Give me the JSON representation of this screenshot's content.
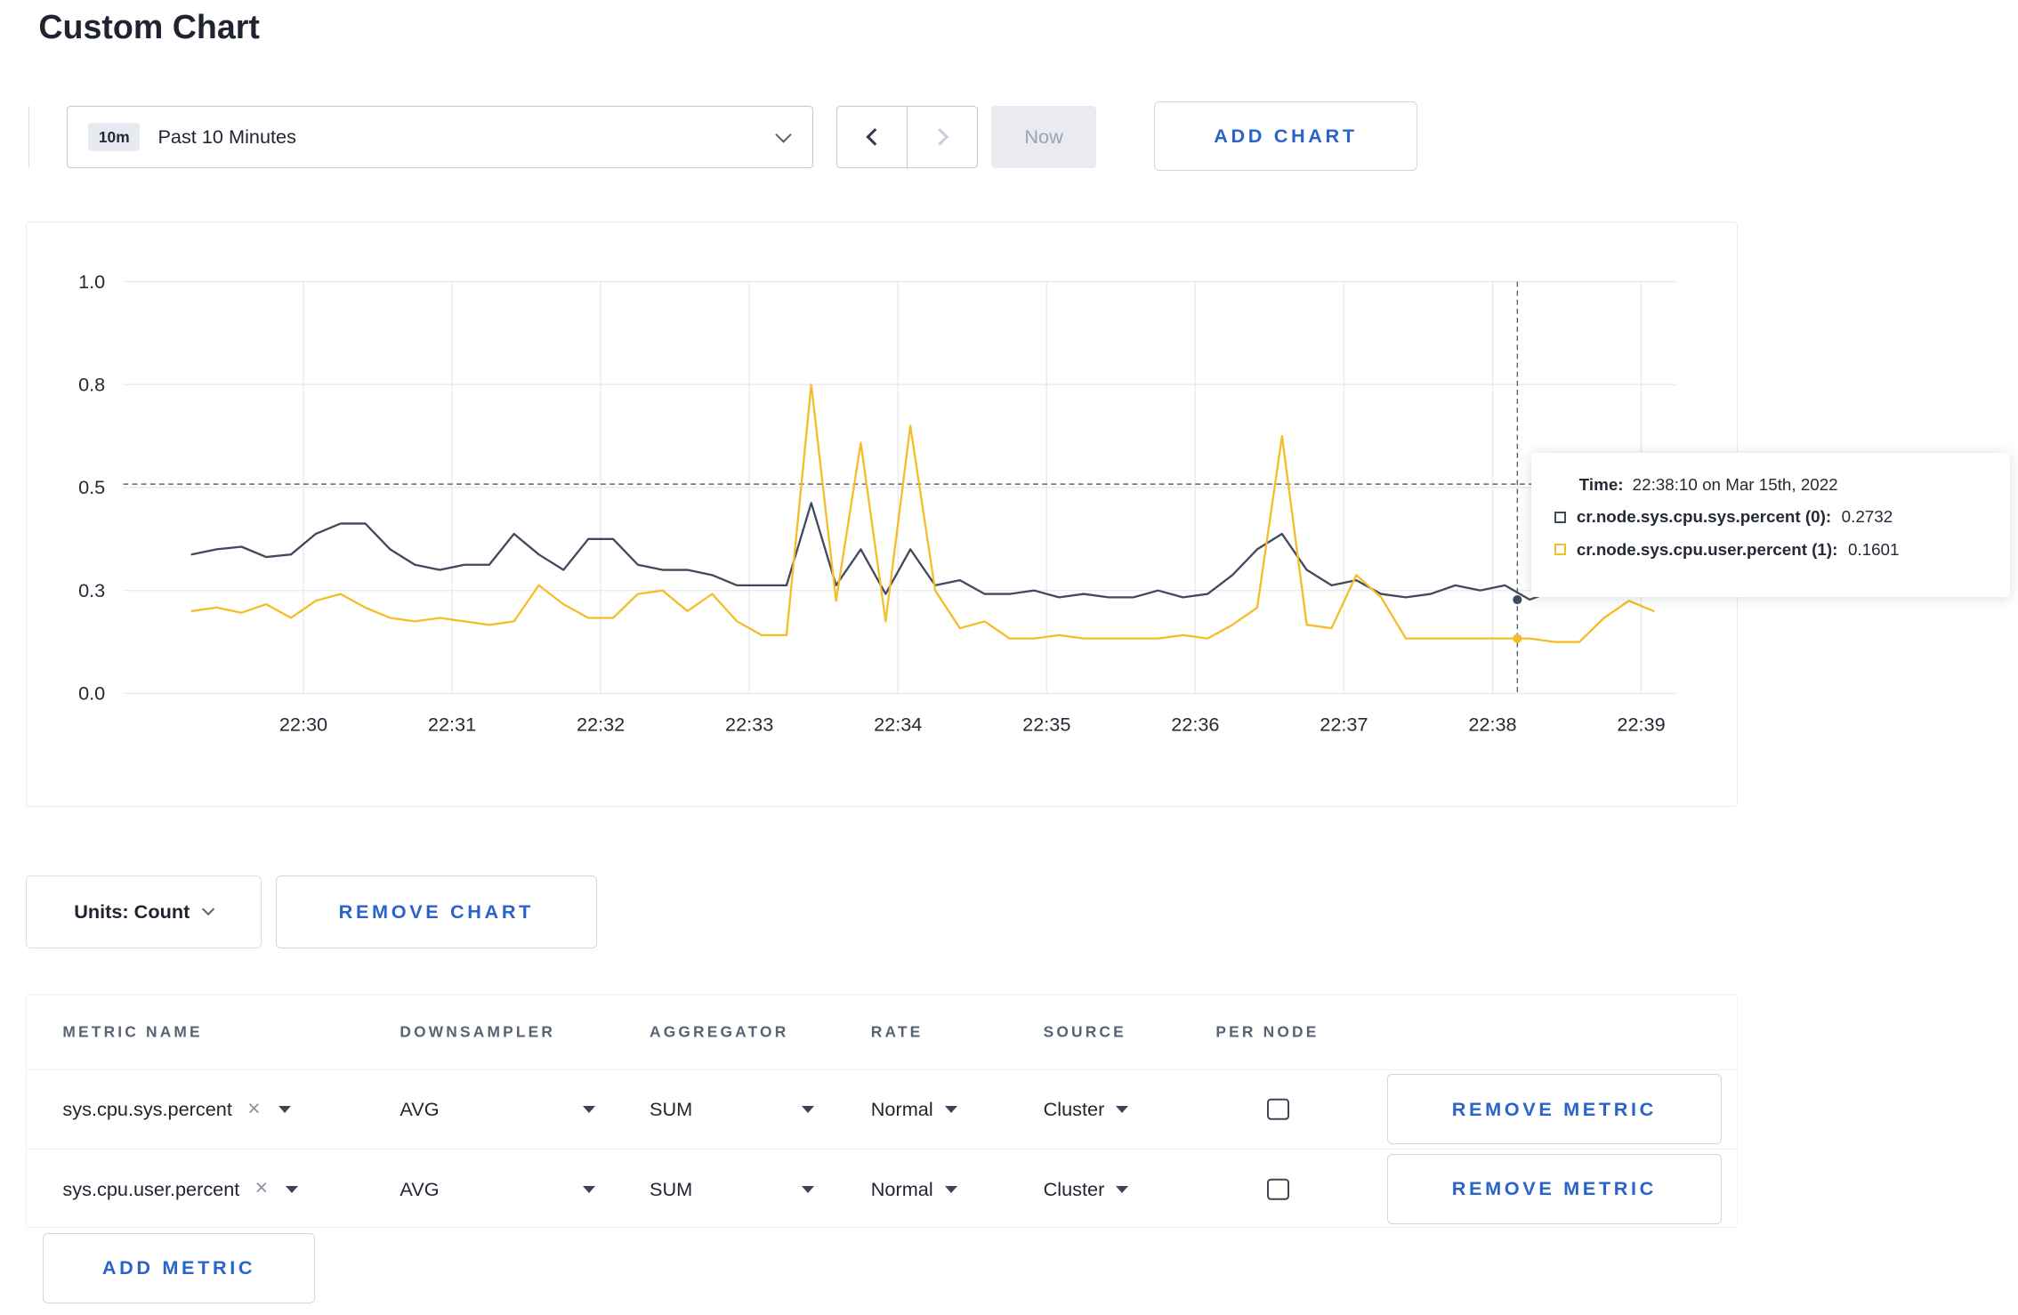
{
  "page": {
    "title": "Custom Chart"
  },
  "colors": {
    "accent_blue": "#2a63c9",
    "series_sys": "#3f4a5c",
    "series_user": "#f5bd27",
    "gridline": "#e9ebf0",
    "crosshair": "#5a6578"
  },
  "icons": {
    "remove_tag": "×"
  },
  "toolbar": {
    "range_badge": "10m",
    "range_label": "Past 10 Minutes",
    "now_label": "Now",
    "add_chart_label": "ADD CHART"
  },
  "tooltip": {
    "time_label": "Time:",
    "time_value": "22:38:10 on Mar 15th, 2022",
    "series": [
      {
        "label": "cr.node.sys.cpu.sys.percent (0):",
        "value": "0.2732",
        "color": "#3f4a5c"
      },
      {
        "label": "cr.node.sys.cpu.user.percent (1):",
        "value": "0.1601",
        "color": "#f5bd27"
      }
    ]
  },
  "units": {
    "label": "Units: Count",
    "remove_chart_label": "REMOVE CHART"
  },
  "metrics": {
    "headers": [
      "METRIC NAME",
      "DOWNSAMPLER",
      "AGGREGATOR",
      "RATE",
      "SOURCE",
      "PER NODE"
    ],
    "rows": [
      {
        "name": "sys.cpu.sys.percent",
        "downsampler": "AVG",
        "aggregator": "SUM",
        "rate": "Normal",
        "source": "Cluster",
        "per_node_checked": false,
        "remove_label": "REMOVE METRIC"
      },
      {
        "name": "sys.cpu.user.percent",
        "downsampler": "AVG",
        "aggregator": "SUM",
        "rate": "Normal",
        "source": "Cluster",
        "per_node_checked": false,
        "remove_label": "REMOVE METRIC"
      }
    ],
    "add_metric_label": "ADD METRIC"
  },
  "chart_data": {
    "type": "line",
    "title": "",
    "xlabel": "",
    "ylabel": "",
    "ylim": [
      0,
      1.0
    ],
    "grid": true,
    "legend_position": "tooltip",
    "x_tick_labels": [
      "22:30",
      "22:31",
      "22:32",
      "22:33",
      "22:34",
      "22:35",
      "22:36",
      "22:37",
      "22:38",
      "22:39"
    ],
    "y_ticks": [
      0,
      0.3,
      0.5,
      0.8,
      1.0
    ],
    "y_tick_labels": [
      "0.0",
      "0.3",
      "0.5",
      "0.8",
      "1.0"
    ],
    "x_start_min": -0.75,
    "x_step_min": 0.1666667,
    "series": [
      {
        "name": "cr.node.sys.cpu.sys.percent",
        "color": "#3f4a5c",
        "values": [
          0.37,
          0.38,
          0.385,
          0.365,
          0.37,
          0.41,
          0.43,
          0.43,
          0.38,
          0.35,
          0.34,
          0.35,
          0.35,
          0.41,
          0.37,
          0.34,
          0.4,
          0.4,
          0.35,
          0.34,
          0.34,
          0.33,
          0.31,
          0.31,
          0.31,
          0.47,
          0.31,
          0.38,
          0.29,
          0.38,
          0.31,
          0.32,
          0.29,
          0.29,
          0.3,
          0.28,
          0.29,
          0.28,
          0.28,
          0.3,
          0.28,
          0.29,
          0.33,
          0.38,
          0.41,
          0.34,
          0.31,
          0.32,
          0.29,
          0.28,
          0.29,
          0.31,
          0.3,
          0.31,
          0.2732,
          0.3,
          0.3,
          0.31,
          0.3,
          0.305
        ]
      },
      {
        "name": "cr.node.sys.cpu.user.percent",
        "color": "#f5bd27",
        "values": [
          0.24,
          0.25,
          0.235,
          0.26,
          0.22,
          0.27,
          0.29,
          0.25,
          0.22,
          0.21,
          0.22,
          0.21,
          0.2,
          0.21,
          0.31,
          0.26,
          0.22,
          0.22,
          0.29,
          0.3,
          0.24,
          0.29,
          0.21,
          0.17,
          0.17,
          0.8,
          0.27,
          0.63,
          0.21,
          0.68,
          0.3,
          0.19,
          0.21,
          0.16,
          0.16,
          0.17,
          0.16,
          0.16,
          0.16,
          0.16,
          0.17,
          0.16,
          0.2,
          0.25,
          0.65,
          0.2,
          0.19,
          0.33,
          0.28,
          0.16,
          0.16,
          0.16,
          0.16,
          0.16,
          0.1601,
          0.15,
          0.15,
          0.22,
          0.27,
          0.24
        ]
      }
    ],
    "crosshair": {
      "time_label": "22:38:10",
      "time_min": 8.1667,
      "values": [
        0.2732,
        0.1601
      ],
      "hline_value": 0.51
    }
  }
}
